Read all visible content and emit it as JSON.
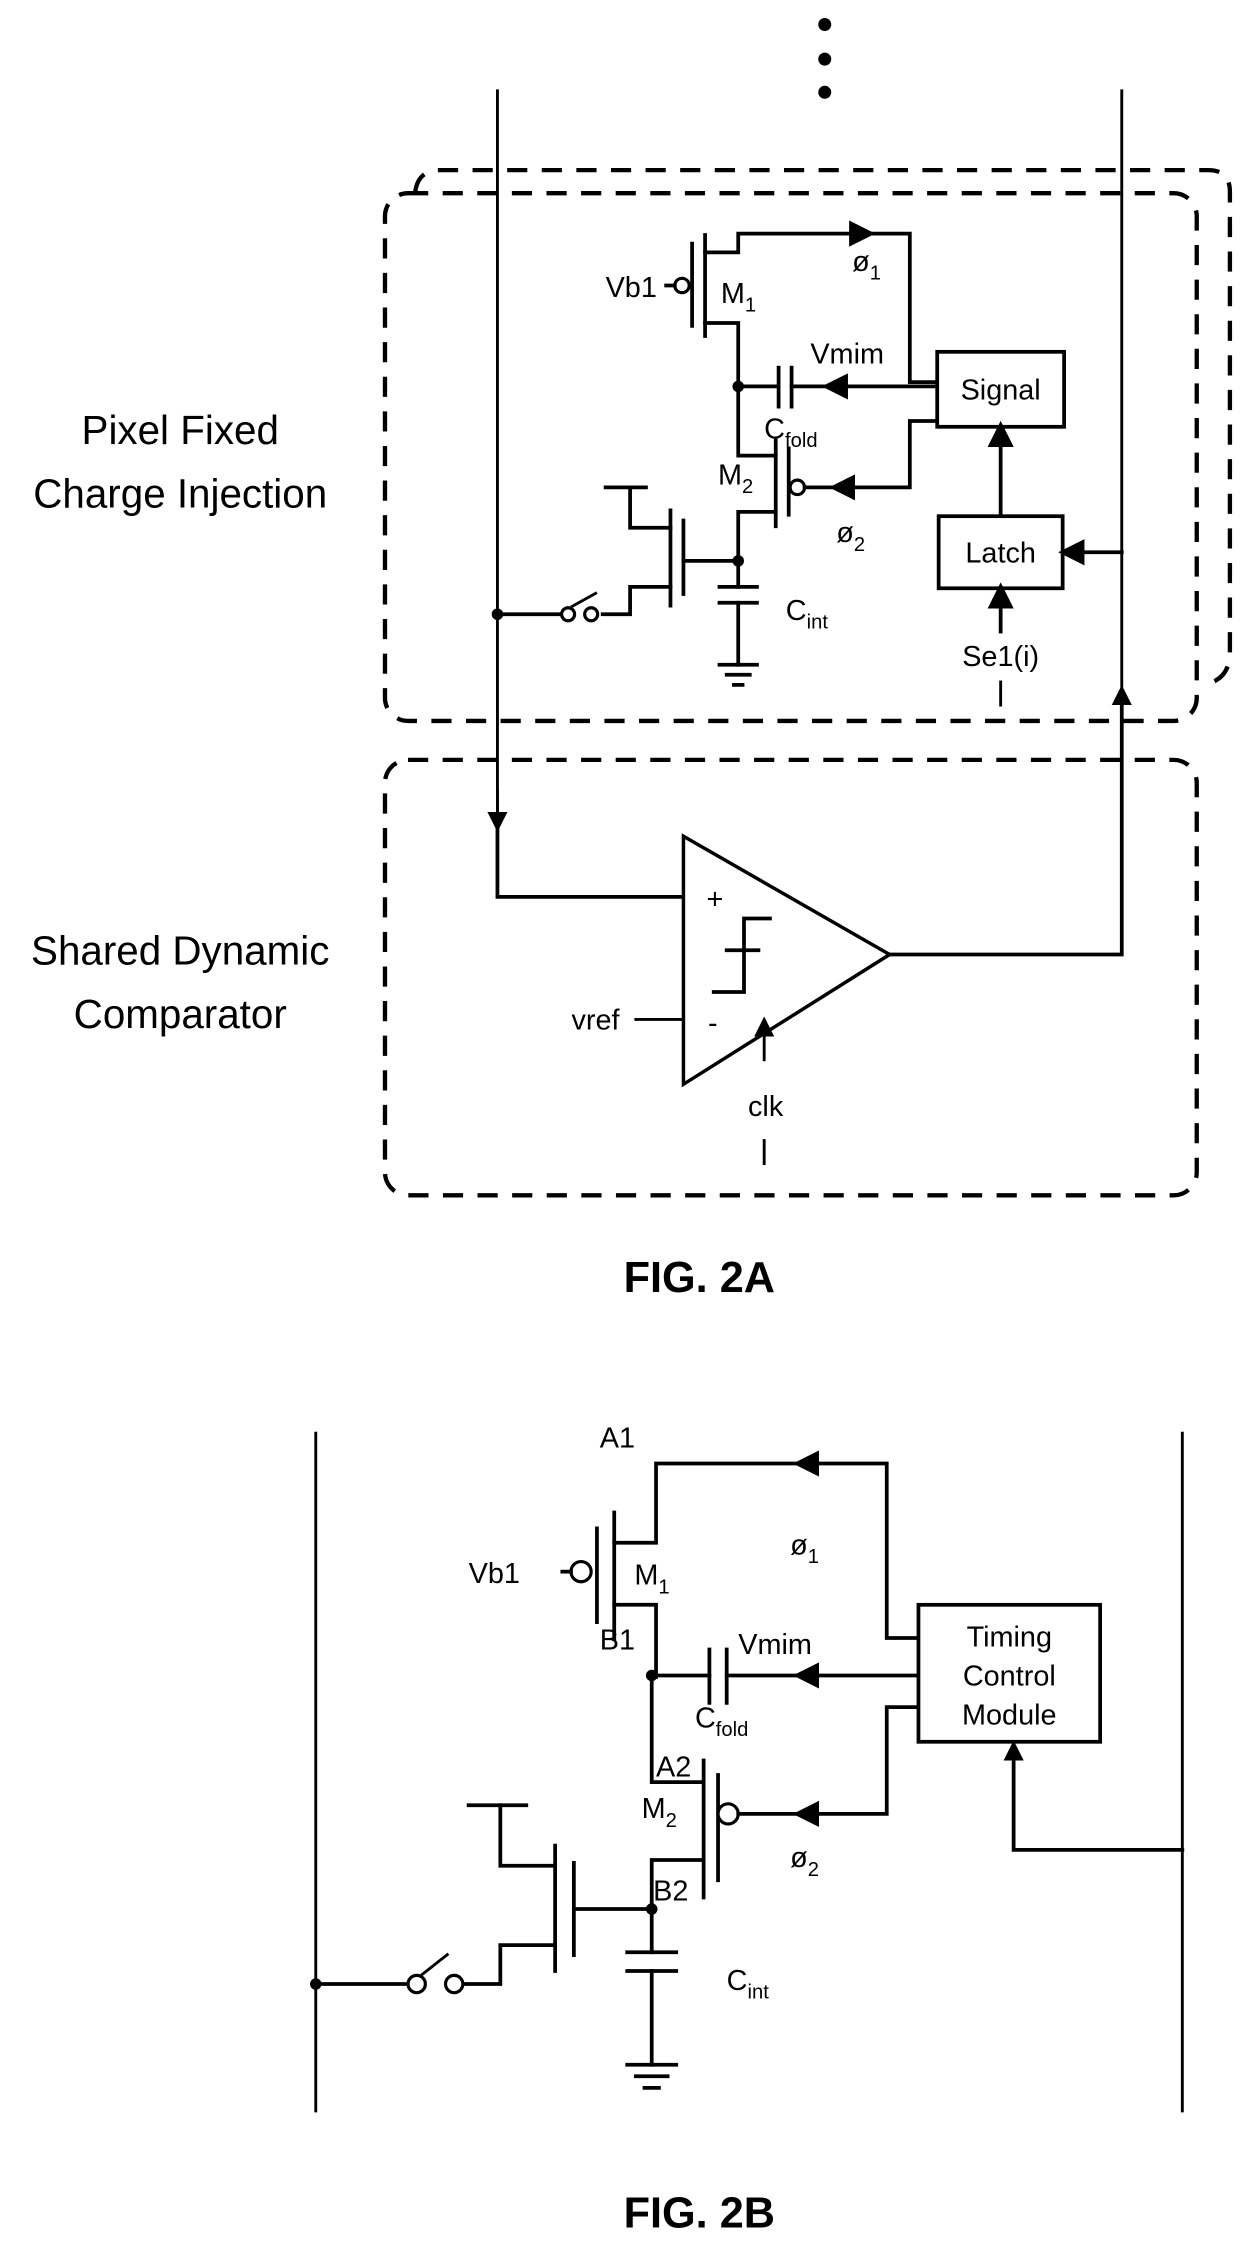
{
  "figures": {
    "fig2a": {
      "caption": "FIG. 2A",
      "regions": {
        "pixel_block": {
          "line1": "Pixel Fixed",
          "line2": "Charge Injection"
        },
        "comparator_block": {
          "line1": "Shared Dynamic",
          "line2": "Comparator"
        }
      },
      "labels": {
        "vb1": "Vb1",
        "m1": "M",
        "m1_sub": "1",
        "m2": "M",
        "m2_sub": "2",
        "phi1": "ø",
        "phi1_sub": "1",
        "phi2": "ø",
        "phi2_sub": "2",
        "vmim": "Vmim",
        "cfold": "C",
        "cfold_sub": "fold",
        "cint": "C",
        "cint_sub": "int",
        "signal": "Signal",
        "latch": "Latch",
        "sel": "Se1(i)",
        "plus": "+",
        "minus": "-",
        "vref": "vref",
        "clk": "clk"
      }
    },
    "fig2b": {
      "caption": "FIG. 2B",
      "labels": {
        "a1": "A1",
        "b1": "B1",
        "a2": "A2",
        "b2": "B2",
        "vb1": "Vb1",
        "m1": "M",
        "m1_sub": "1",
        "m2": "M",
        "m2_sub": "2",
        "phi1": "ø",
        "phi1_sub": "1",
        "phi2": "ø",
        "phi2_sub": "2",
        "vmim": "Vmim",
        "cfold": "C",
        "cfold_sub": "fold",
        "cint": "C",
        "cint_sub": "int",
        "timing_l1": "Timing",
        "timing_l2": "Control",
        "timing_l3": "Module"
      }
    }
  }
}
